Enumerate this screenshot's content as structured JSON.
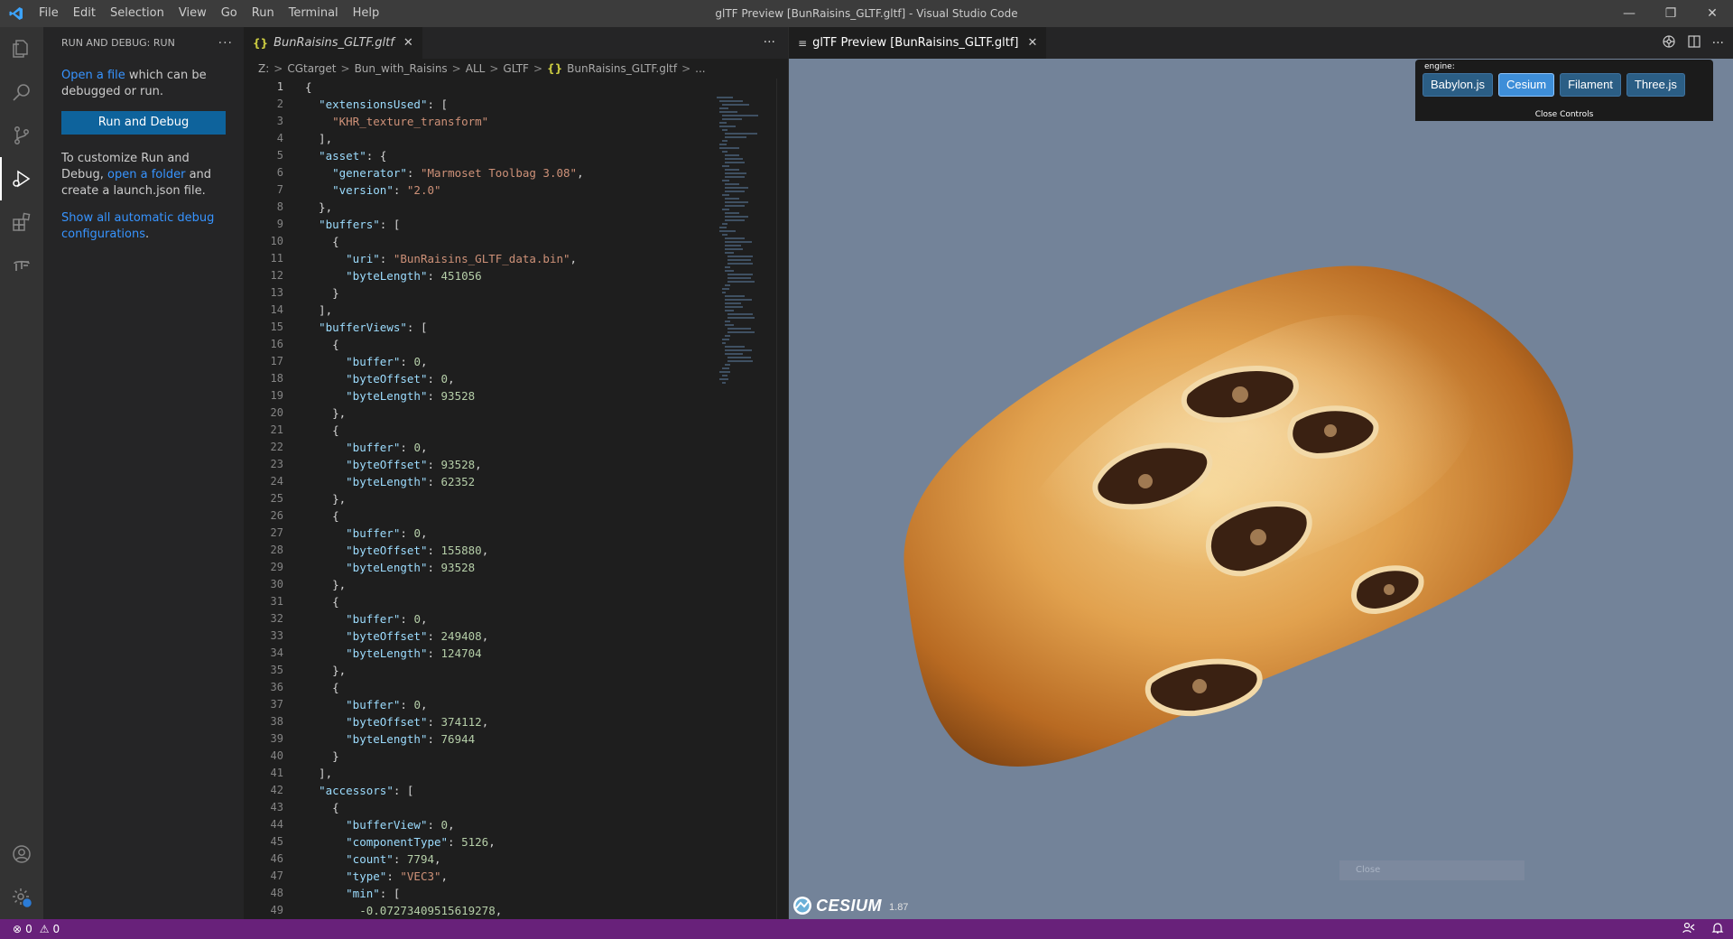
{
  "window": {
    "title": "glTF Preview [BunRaisins_GLTF.gltf] - Visual Studio Code"
  },
  "menu": [
    "File",
    "Edit",
    "Selection",
    "View",
    "Go",
    "Run",
    "Terminal",
    "Help"
  ],
  "sidebar": {
    "header": "RUN AND DEBUG: RUN",
    "open_file_link": "Open a file",
    "open_file_rest": " which can be debugged or run.",
    "run_button": "Run and Debug",
    "customize_pre": "To customize Run and Debug, ",
    "open_folder_link": "open a folder",
    "customize_post": " and create a launch.json file.",
    "show_configs_link": "Show all automatic debug configurations",
    "show_configs_end": "."
  },
  "editor": {
    "tab_label": "BunRaisins_GLTF.gltf",
    "breadcrumb": [
      "Z:",
      "CGtarget",
      "Bun_with_Raisins",
      "ALL",
      "GLTF",
      "BunRaisins_GLTF.gltf",
      "..."
    ],
    "lines": [
      "{",
      "  \"extensionsUsed\": [",
      "    \"KHR_texture_transform\"",
      "  ],",
      "  \"asset\": {",
      "    \"generator\": \"Marmoset Toolbag 3.08\",",
      "    \"version\": \"2.0\"",
      "  },",
      "  \"buffers\": [",
      "    {",
      "      \"uri\": \"BunRaisins_GLTF_data.bin\",",
      "      \"byteLength\": 451056",
      "    }",
      "  ],",
      "  \"bufferViews\": [",
      "    {",
      "      \"buffer\": 0,",
      "      \"byteOffset\": 0,",
      "      \"byteLength\": 93528",
      "    },",
      "    {",
      "      \"buffer\": 0,",
      "      \"byteOffset\": 93528,",
      "      \"byteLength\": 62352",
      "    },",
      "    {",
      "      \"buffer\": 0,",
      "      \"byteOffset\": 155880,",
      "      \"byteLength\": 93528",
      "    },",
      "    {",
      "      \"buffer\": 0,",
      "      \"byteOffset\": 249408,",
      "      \"byteLength\": 124704",
      "    },",
      "    {",
      "      \"buffer\": 0,",
      "      \"byteOffset\": 374112,",
      "      \"byteLength\": 76944",
      "    }",
      "  ],",
      "  \"accessors\": [",
      "    {",
      "      \"bufferView\": 0,",
      "      \"componentType\": 5126,",
      "      \"count\": 7794,",
      "      \"type\": \"VEC3\",",
      "      \"min\": [",
      "        -0.07273409515619278,"
    ]
  },
  "preview": {
    "tab_label": "glTF Preview [BunRaisins_GLTF.gltf]",
    "engine_label": "engine:",
    "engines": [
      "Babylon.js",
      "Cesium",
      "Filament",
      "Three.js"
    ],
    "active_engine": "Cesium",
    "close_controls": "Close Controls",
    "logo_text": "CESIUM",
    "logo_version": "1.87",
    "overlay_text": "Close"
  },
  "statusbar": {
    "errors": "0",
    "warnings": "0"
  },
  "colors": {
    "statusbar": "#68217a",
    "viewport_bg": "#738399",
    "accent": "#0e639c"
  }
}
